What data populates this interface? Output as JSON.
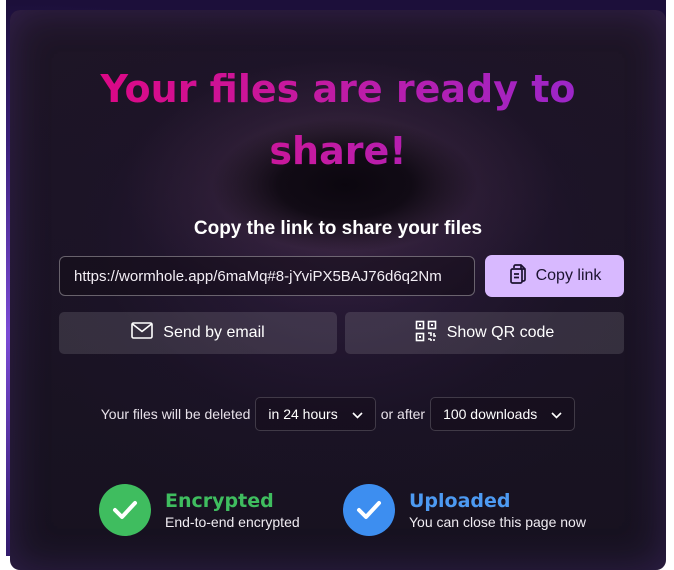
{
  "page": {
    "title_line1": "Your files are ready to",
    "title_line2": "share!",
    "subtitle": "Copy the link to share your files"
  },
  "share": {
    "link_value": "https://wormhole.app/6maMq#8-jYviPX5BAJ76d6q2Nm",
    "copy_label": "Copy link",
    "email_label": "Send by email",
    "qr_label": "Show QR code"
  },
  "expiry": {
    "prefix": "Your files will be deleted",
    "time_value": "in 24 hours",
    "middle": "or after",
    "downloads_value": "100 downloads"
  },
  "status": {
    "encrypted_title": "Encrypted",
    "encrypted_sub": "End-to-end encrypted",
    "uploaded_title": "Uploaded",
    "uploaded_sub": "You can close this page now"
  },
  "colors": {
    "accent_button": "#d8b9ff",
    "title_gradient_start": "#e6007a",
    "title_gradient_end": "#8e2ad6",
    "encrypted_green": "#3fbd5f",
    "uploaded_blue": "#3d8ef0"
  },
  "icons": {
    "copy": "copy-icon",
    "email": "mail-icon",
    "qr": "qr-code-icon",
    "dropdown": "chevron-down-icon",
    "check": "check-icon"
  }
}
